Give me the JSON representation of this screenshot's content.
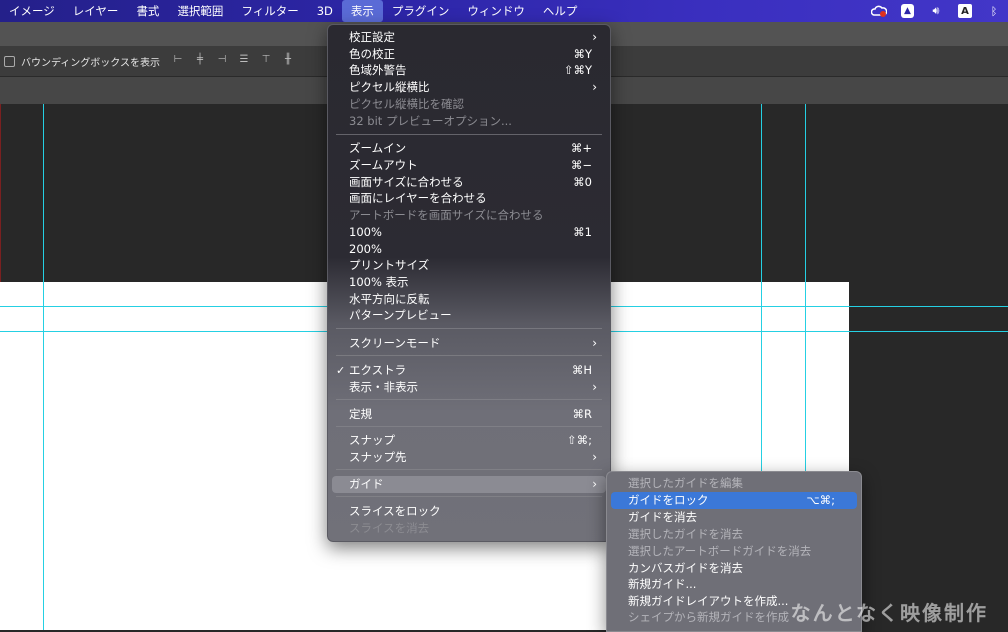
{
  "menubar": {
    "items": [
      "イメージ",
      "レイヤー",
      "書式",
      "選択範囲",
      "フィルター",
      "3D",
      "表示",
      "プラグイン",
      "ウィンドウ",
      "ヘルプ"
    ],
    "active_index": 6,
    "status_icons": [
      "creative-cloud-icon",
      "shield-app-icon",
      "volume-icon",
      "input-source-icon",
      "bluetooth-icon"
    ],
    "input_source_label": "A"
  },
  "options_bar": {
    "bounding_box_label": "バウンディングボックスを表示"
  },
  "view_menu": {
    "items": [
      {
        "label": "校正設定",
        "shortcut": "",
        "submenu": true,
        "disabled": false
      },
      {
        "label": "色の校正",
        "shortcut": "⌘Y",
        "submenu": false,
        "disabled": false
      },
      {
        "label": "色域外警告",
        "shortcut": "⇧⌘Y",
        "submenu": false,
        "disabled": false
      },
      {
        "label": "ピクセル縦横比",
        "shortcut": "",
        "submenu": true,
        "disabled": false
      },
      {
        "label": "ピクセル縦横比を確認",
        "shortcut": "",
        "submenu": false,
        "disabled": true
      },
      {
        "label": "32 bit プレビューオプション...",
        "shortcut": "",
        "submenu": false,
        "disabled": true
      },
      {
        "label": "ズームイン",
        "shortcut": "⌘+",
        "submenu": false,
        "disabled": false
      },
      {
        "label": "ズームアウト",
        "shortcut": "⌘−",
        "submenu": false,
        "disabled": false
      },
      {
        "label": "画面サイズに合わせる",
        "shortcut": "⌘0",
        "submenu": false,
        "disabled": false
      },
      {
        "label": "画面にレイヤーを合わせる",
        "shortcut": "",
        "submenu": false,
        "disabled": false
      },
      {
        "label": "アートボードを画面サイズに合わせる",
        "shortcut": "",
        "submenu": false,
        "disabled": true
      },
      {
        "label": "100%",
        "shortcut": "⌘1",
        "submenu": false,
        "disabled": false
      },
      {
        "label": "200%",
        "shortcut": "",
        "submenu": false,
        "disabled": false
      },
      {
        "label": "プリントサイズ",
        "shortcut": "",
        "submenu": false,
        "disabled": false
      },
      {
        "label": "100% 表示",
        "shortcut": "",
        "submenu": false,
        "disabled": false
      },
      {
        "label": "水平方向に反転",
        "shortcut": "",
        "submenu": false,
        "disabled": false
      },
      {
        "label": "パターンプレビュー",
        "shortcut": "",
        "submenu": false,
        "disabled": false
      },
      {
        "label": "スクリーンモード",
        "shortcut": "",
        "submenu": true,
        "disabled": false
      },
      {
        "label": "エクストラ",
        "shortcut": "⌘H",
        "submenu": false,
        "disabled": false,
        "checked": true
      },
      {
        "label": "表示・非表示",
        "shortcut": "",
        "submenu": true,
        "disabled": false
      },
      {
        "label": "定規",
        "shortcut": "⌘R",
        "submenu": false,
        "disabled": false
      },
      {
        "label": "スナップ",
        "shortcut": "⇧⌘;",
        "submenu": false,
        "disabled": false
      },
      {
        "label": "スナップ先",
        "shortcut": "",
        "submenu": true,
        "disabled": false
      },
      {
        "label": "ガイド",
        "shortcut": "",
        "submenu": true,
        "disabled": false,
        "highlighted": true
      },
      {
        "label": "スライスをロック",
        "shortcut": "",
        "submenu": false,
        "disabled": false
      },
      {
        "label": "スライスを消去",
        "shortcut": "",
        "submenu": false,
        "disabled": true
      }
    ]
  },
  "guide_submenu": {
    "items": [
      {
        "label": "選択したガイドを編集",
        "shortcut": "",
        "disabled": true
      },
      {
        "label": "ガイドをロック",
        "shortcut": "⌥⌘;",
        "disabled": false,
        "selected": true
      },
      {
        "label": "ガイドを消去",
        "shortcut": "",
        "disabled": false
      },
      {
        "label": "選択したガイドを消去",
        "shortcut": "",
        "disabled": true
      },
      {
        "label": "選択したアートボードガイドを消去",
        "shortcut": "",
        "disabled": true
      },
      {
        "label": "カンバスガイドを消去",
        "shortcut": "",
        "disabled": false
      },
      {
        "label": "新規ガイド...",
        "shortcut": "",
        "disabled": false
      },
      {
        "label": "新規ガイドレイアウトを作成...",
        "shortcut": "",
        "disabled": false
      },
      {
        "label": "シェイプから新規ガイドを作成",
        "shortcut": "",
        "disabled": true
      }
    ]
  },
  "watermark": "なんとなく映像制作",
  "colors": {
    "guide": "#25d0e3",
    "menubar": "#2d26a8",
    "selection": "#3b78d8"
  }
}
